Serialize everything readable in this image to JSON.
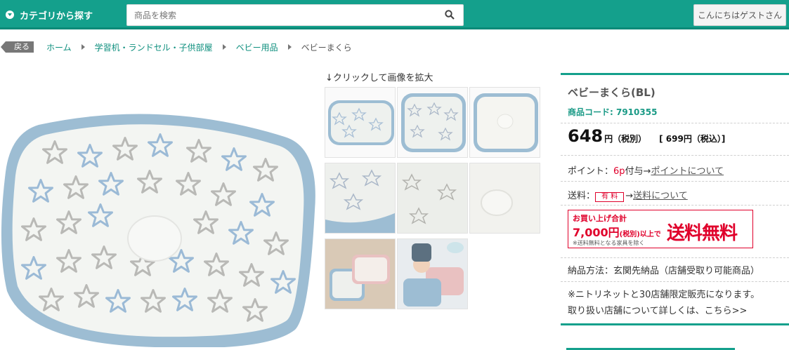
{
  "header": {
    "category_button": "カテゴリから探す",
    "search_placeholder": "商品を検索",
    "greeting": "こんにちはゲストさん"
  },
  "breadcrumb": {
    "back": "戻る",
    "items": [
      "ホーム",
      "学習机・ランドセル・子供部屋",
      "ベビー用品"
    ],
    "current": "ベビーまくら"
  },
  "gallery": {
    "zoom_hint": "↓クリックして画像を拡大"
  },
  "product": {
    "title": "ベビーまくら(BL)",
    "code": "商品コード: 7910355",
    "price": "648",
    "price_unit": "円（税別）",
    "price_tax": "[ 699円（税込）]",
    "points_label": "ポイント：",
    "points_value": "6p",
    "points_suffix": "付与→",
    "points_link": "ポイントについて",
    "shipping_label": "送料：",
    "shipping_badge": "有 料",
    "shipping_arrow": "→",
    "shipping_link": "送料について",
    "banner_line1": "お買い上げ合計",
    "banner_amount": "7,000円",
    "banner_amount_note": "(税別)以上で",
    "banner_free": "送料無料",
    "banner_footnote": "※送料無料となる家具を除く",
    "delivery": "納品方法：玄関先納品（店舗受取り可能商品）",
    "note_line1": "※ニトリネットと30店舗限定販売になります。",
    "note_line2": "取り扱い店舗について詳しくは、こちら>>"
  },
  "colors": {
    "brand": "#14a08c",
    "accent_red": "#e0002b",
    "pillow_trim": "#9dbdd3"
  }
}
